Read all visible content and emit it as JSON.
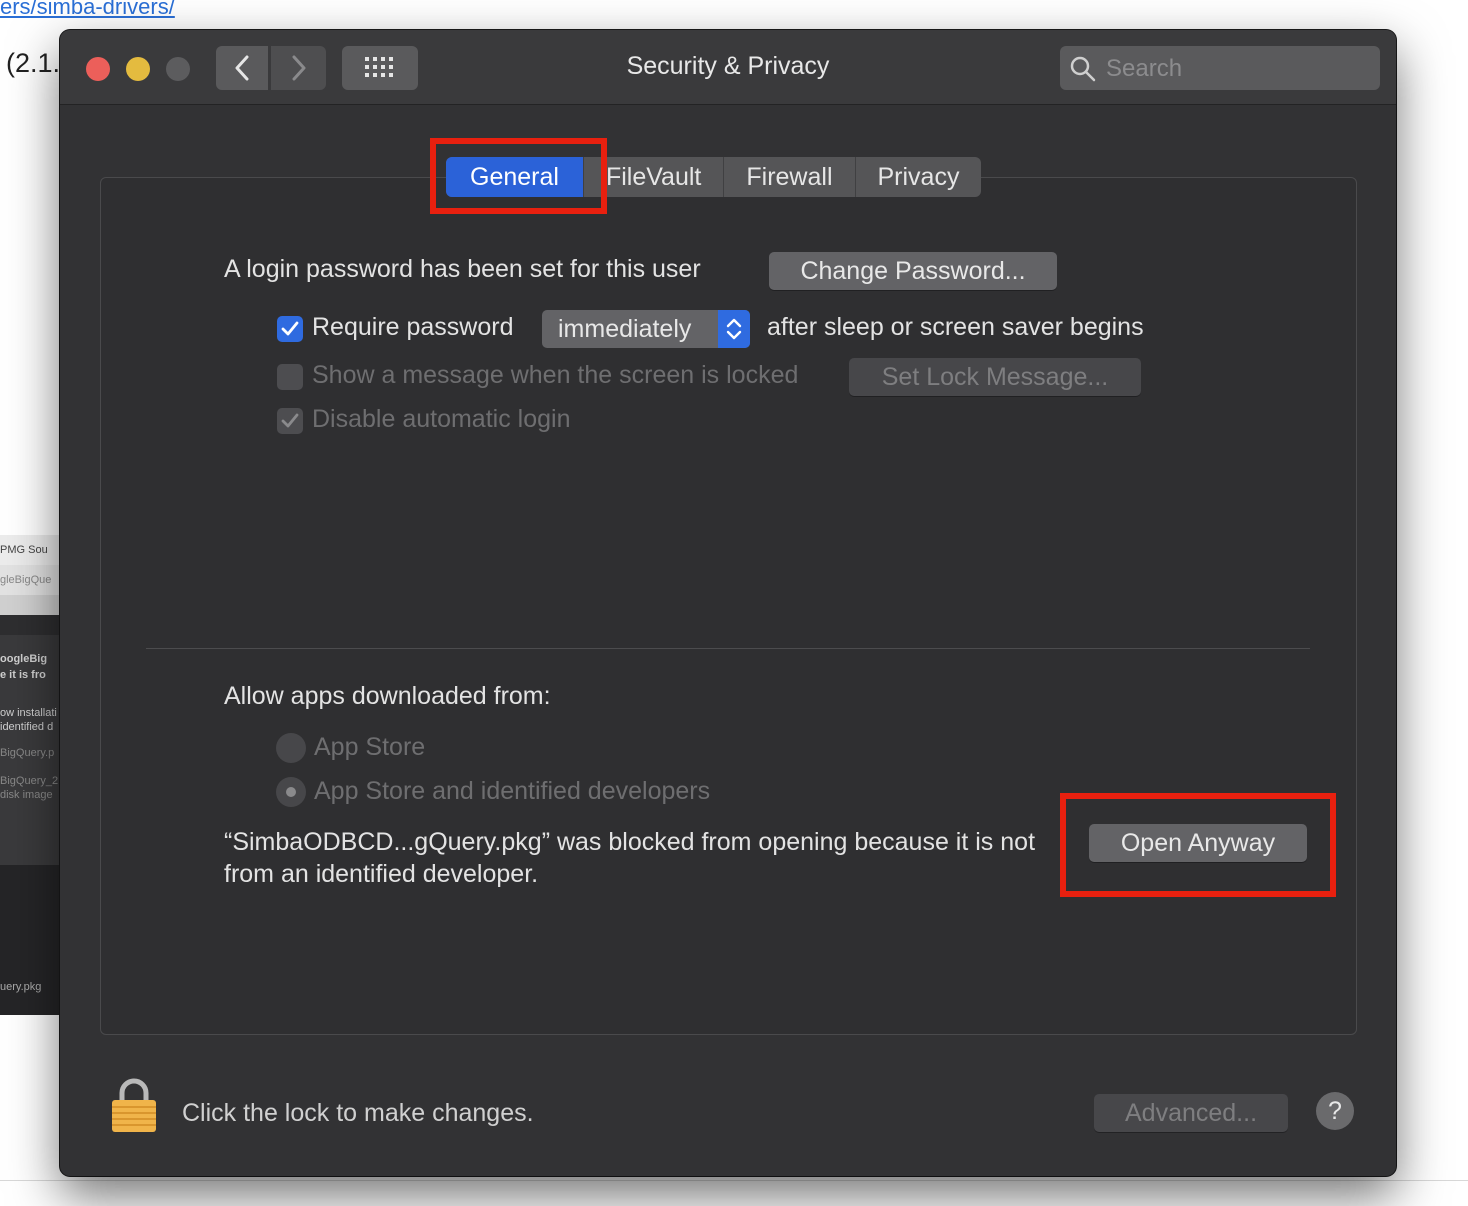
{
  "background": {
    "url_fragment": "ers/simba-drivers/",
    "text_fragment": "(2.1.",
    "finder": {
      "lines": [
        "PMG Sou",
        "gleBigQue",
        "oogleBig",
        "e it is fro",
        "ow installati",
        "identified d",
        "BigQuery.p",
        "BigQuery_2",
        "disk image",
        "uery.pkg"
      ]
    }
  },
  "window": {
    "title": "Security & Privacy",
    "search_placeholder": "Search"
  },
  "tabs": [
    {
      "label": "General",
      "active": true
    },
    {
      "label": "FileVault",
      "active": false
    },
    {
      "label": "Firewall",
      "active": false
    },
    {
      "label": "Privacy",
      "active": false
    }
  ],
  "general": {
    "login_text": "A login password has been set for this user",
    "change_password": "Change Password...",
    "require_password_label": "Require password",
    "require_password_checked": true,
    "require_password_value": "immediately",
    "after_sleep_text": "after sleep or screen saver begins",
    "show_message_label": "Show a message when the screen is locked",
    "show_message_checked": false,
    "set_lock_message": "Set Lock Message...",
    "disable_auto_login_label": "Disable automatic login",
    "disable_auto_login_checked": true
  },
  "allow_apps": {
    "heading": "Allow apps downloaded from:",
    "options": [
      {
        "label": "App Store",
        "selected": false
      },
      {
        "label": "App Store and identified developers",
        "selected": true
      }
    ],
    "blocked_message": "“SimbaODBCD...gQuery.pkg” was blocked from opening because it is not from an identified developer.",
    "open_anyway": "Open Anyway"
  },
  "footer": {
    "lock_text": "Click the lock to make changes.",
    "advanced": "Advanced...",
    "help": "?"
  },
  "colors": {
    "highlight_red": "#e8200f",
    "accent_blue": "#2b62d8"
  }
}
